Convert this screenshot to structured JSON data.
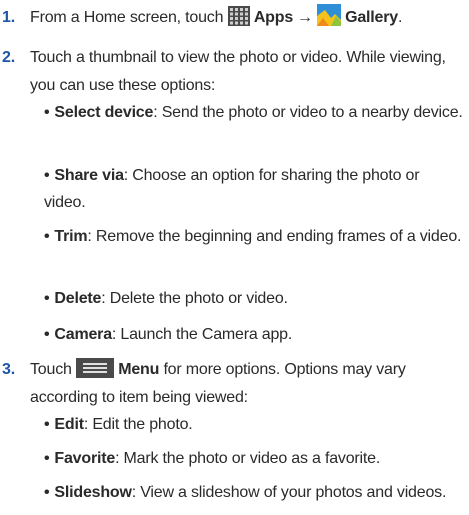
{
  "steps": [
    {
      "number": "1.",
      "text_before": "From a Home screen, touch",
      "apps_label": "Apps",
      "arrow": "→",
      "gallery_label": "Gallery",
      "end": "."
    },
    {
      "number": "2.",
      "text": "Touch a thumbnail to view the photo or video. While viewing, you can use these options:",
      "options": [
        {
          "label": "Select device",
          "desc": ": Send the photo or video to a nearby device."
        },
        {
          "label": "Share via",
          "desc": ": Choose an option for sharing the photo or video."
        },
        {
          "label": "Trim",
          "desc": ": Remove the beginning and ending frames of a video."
        },
        {
          "label": "Delete",
          "desc": ": Delete the photo or video."
        },
        {
          "label": "Camera",
          "desc": ": Launch the Camera app."
        }
      ]
    },
    {
      "number": "3.",
      "text_before": "Touch",
      "menu_label": "Menu",
      "text_after": "for more options. Options may vary according to item being viewed:",
      "options": [
        {
          "label": "Edit",
          "desc": ": Edit the photo."
        },
        {
          "label": "Favorite",
          "desc": ": Mark the photo or video as a favorite."
        },
        {
          "label": "Slideshow",
          "desc": ": View a slideshow of your photos and videos."
        }
      ]
    }
  ],
  "bullet_char": "•",
  "icons": {
    "apps": "apps-grid-icon",
    "gallery": "gallery-icon",
    "menu": "menu-icon"
  },
  "colors": {
    "step_number": "#1d56a6",
    "text": "#2a2a2a"
  }
}
